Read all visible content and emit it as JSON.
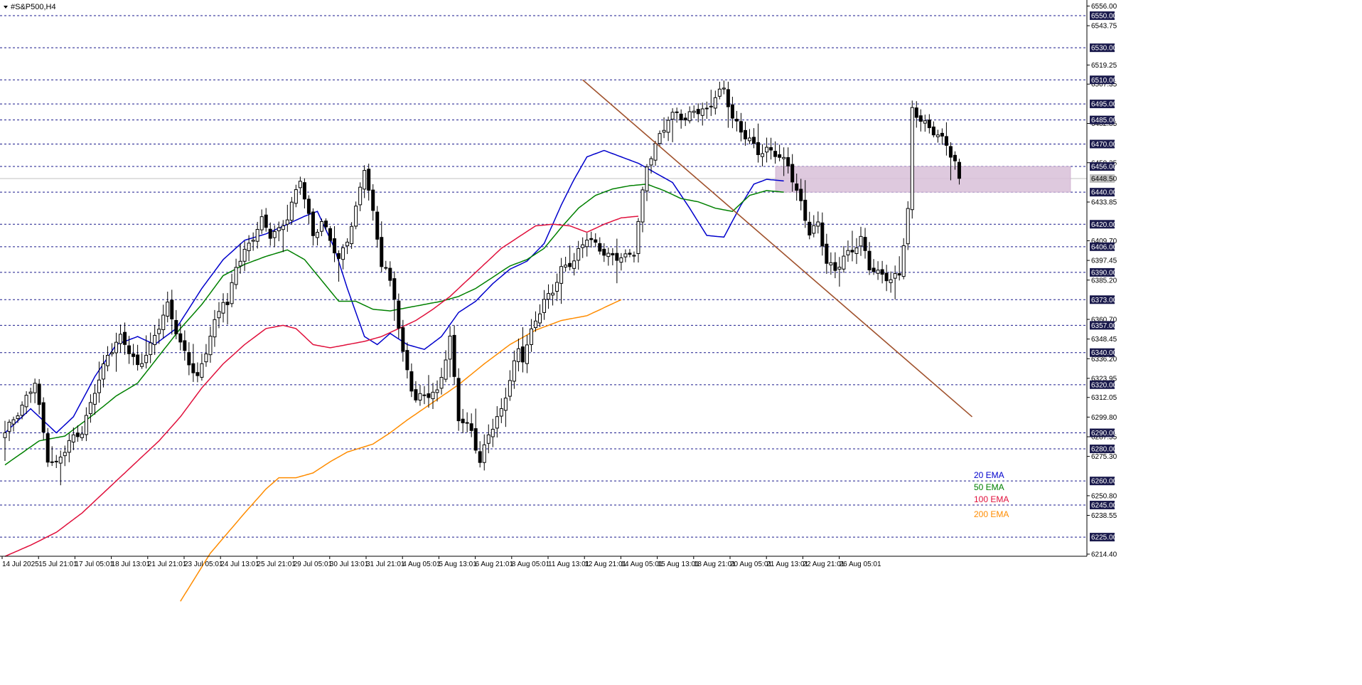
{
  "window": {
    "title": "#S&P500,H4"
  },
  "chart_data": {
    "type": "candlestick",
    "symbol": "#S&P500",
    "timeframe": "H4",
    "y_range": [
      6214.4,
      6556.0
    ],
    "y_ticks": [
      "6556.00",
      "6543.75",
      "6519.25",
      "6507.35",
      "6482.85",
      "6458.35",
      "6433.85",
      "6409.70",
      "6397.45",
      "6385.20",
      "6360.70",
      "6348.45",
      "6336.20",
      "6323.95",
      "6312.05",
      "6299.80",
      "6287.55",
      "6275.30",
      "6250.80",
      "6238.55",
      "6214.40"
    ],
    "level_labels": [
      "6550.00",
      "6530.00",
      "6510.00",
      "6495.00",
      "6485.00",
      "6470.00",
      "6456.00",
      "6440.00",
      "6420.00",
      "6406.00",
      "6390.00",
      "6373.00",
      "6357.00",
      "6340.00",
      "6320.00",
      "6290.00",
      "6280.00",
      "6260.00",
      "6245.00",
      "6225.00"
    ],
    "current_price": "6448.50",
    "x_labels": [
      "14 Jul 2025",
      "15 Jul 21:01",
      "17 Jul 05:01",
      "18 Jul 13:01",
      "21 Jul 21:01",
      "23 Jul 05:01",
      "24 Jul 13:01",
      "25 Jul 21:01",
      "29 Jul 05:01",
      "30 Jul 13:01",
      "31 Jul 21:01",
      "4 Aug 05:01",
      "5 Aug 13:01",
      "6 Aug 21:01",
      "8 Aug 05:01",
      "11 Aug 13:01",
      "12 Aug 21:01",
      "14 Aug 05:01",
      "15 Aug 13:01",
      "18 Aug 21:01",
      "20 Aug 05:01",
      "21 Aug 13:01",
      "22 Aug 21:01",
      "26 Aug 05:01"
    ],
    "legend": [
      {
        "name": "20 EMA",
        "color": "#0000cc"
      },
      {
        "name": "50 EMA",
        "color": "#008000"
      },
      {
        "name": "100 EMA",
        "color": "#e0103c"
      },
      {
        "name": "200 EMA",
        "color": "#ff8c00"
      }
    ],
    "zone": {
      "from": 6440,
      "to": 6456,
      "color": "#d8bfd8"
    },
    "trendline": {
      "color": "#a0522d",
      "start": {
        "bar": 135,
        "price": 6510
      },
      "end": {
        "bar": 226,
        "price": 6300
      }
    },
    "close_anchors": [
      [
        0,
        6290
      ],
      [
        4,
        6305
      ],
      [
        7,
        6323
      ],
      [
        10,
        6275
      ],
      [
        12,
        6270
      ],
      [
        15,
        6283
      ],
      [
        18,
        6291
      ],
      [
        21,
        6318
      ],
      [
        24,
        6338
      ],
      [
        27,
        6348
      ],
      [
        28,
        6345
      ],
      [
        31,
        6332
      ],
      [
        34,
        6345
      ],
      [
        38,
        6368
      ],
      [
        41,
        6345
      ],
      [
        43,
        6335
      ],
      [
        45,
        6325
      ],
      [
        48,
        6350
      ],
      [
        51,
        6372
      ],
      [
        52,
        6368
      ],
      [
        54,
        6395
      ],
      [
        56,
        6404
      ],
      [
        60,
        6422
      ],
      [
        62,
        6412
      ],
      [
        64,
        6415
      ],
      [
        66,
        6425
      ],
      [
        69,
        6450
      ],
      [
        72,
        6412
      ],
      [
        74,
        6420
      ],
      [
        76,
        6410
      ],
      [
        78,
        6398
      ],
      [
        80,
        6412
      ],
      [
        82,
        6430
      ],
      [
        84,
        6455
      ],
      [
        86,
        6425
      ],
      [
        88,
        6395
      ],
      [
        89,
        6392
      ],
      [
        91,
        6376
      ],
      [
        93,
        6340
      ],
      [
        95,
        6318
      ],
      [
        96,
        6310
      ],
      [
        98,
        6312
      ],
      [
        101,
        6315
      ],
      [
        104,
        6350
      ],
      [
        106,
        6300
      ],
      [
        109,
        6290
      ],
      [
        111,
        6270
      ],
      [
        113,
        6290
      ],
      [
        116,
        6305
      ],
      [
        118,
        6324
      ],
      [
        120,
        6341
      ],
      [
        121,
        6335
      ],
      [
        124,
        6360
      ],
      [
        126,
        6373
      ],
      [
        128,
        6380
      ],
      [
        130,
        6392
      ],
      [
        133,
        6396
      ],
      [
        136,
        6412
      ],
      [
        139,
        6406
      ],
      [
        141,
        6401
      ],
      [
        143,
        6399
      ],
      [
        145,
        6398
      ],
      [
        147,
        6402
      ],
      [
        149,
        6440
      ],
      [
        150,
        6458
      ],
      [
        153,
        6476
      ],
      [
        155,
        6485
      ],
      [
        157,
        6488
      ],
      [
        159,
        6484
      ],
      [
        161,
        6492
      ],
      [
        164,
        6492
      ],
      [
        166,
        6500
      ],
      [
        168,
        6503
      ],
      [
        170,
        6485
      ],
      [
        172,
        6478
      ],
      [
        174,
        6474
      ],
      [
        176,
        6466
      ],
      [
        178,
        6466
      ],
      [
        180,
        6463
      ],
      [
        183,
        6456
      ],
      [
        186,
        6434
      ],
      [
        188,
        6416
      ],
      [
        190,
        6420
      ],
      [
        192,
        6395
      ],
      [
        194,
        6390
      ],
      [
        196,
        6400
      ],
      [
        198,
        6405
      ],
      [
        200,
        6412
      ],
      [
        202,
        6393
      ],
      [
        204,
        6388
      ],
      [
        207,
        6385
      ],
      [
        209,
        6390
      ],
      [
        211,
        6430
      ],
      [
        212,
        6492
      ],
      [
        214,
        6485
      ],
      [
        216,
        6478
      ],
      [
        218,
        6475
      ],
      [
        220,
        6470
      ],
      [
        222,
        6460
      ],
      [
        223,
        6448
      ]
    ],
    "ema_anchors": {
      "ema20": [
        [
          0,
          6290
        ],
        [
          6,
          6305
        ],
        [
          12,
          6290
        ],
        [
          16,
          6300
        ],
        [
          21,
          6325
        ],
        [
          26,
          6345
        ],
        [
          31,
          6350
        ],
        [
          35,
          6345
        ],
        [
          40,
          6355
        ],
        [
          46,
          6380
        ],
        [
          51,
          6398
        ],
        [
          56,
          6410
        ],
        [
          61,
          6414
        ],
        [
          66,
          6420
        ],
        [
          70,
          6425
        ],
        [
          73,
          6428
        ],
        [
          77,
          6405
        ],
        [
          80,
          6380
        ],
        [
          84,
          6350
        ],
        [
          87,
          6345
        ],
        [
          90,
          6352
        ],
        [
          94,
          6345
        ],
        [
          98,
          6342
        ],
        [
          102,
          6350
        ],
        [
          106,
          6365
        ],
        [
          110,
          6372
        ],
        [
          114,
          6383
        ],
        [
          118,
          6392
        ],
        [
          122,
          6397
        ],
        [
          126,
          6408
        ],
        [
          130,
          6432
        ],
        [
          133,
          6448
        ],
        [
          136,
          6462
        ],
        [
          140,
          6466
        ],
        [
          144,
          6462
        ],
        [
          148,
          6458
        ],
        [
          152,
          6452
        ],
        [
          156,
          6446
        ],
        [
          160,
          6430
        ],
        [
          164,
          6413
        ],
        [
          168,
          6412
        ],
        [
          172,
          6432
        ],
        [
          175,
          6445
        ],
        [
          178,
          6448
        ],
        [
          182,
          6447
        ]
      ],
      "ema50": [
        [
          0,
          6270
        ],
        [
          8,
          6285
        ],
        [
          14,
          6288
        ],
        [
          20,
          6300
        ],
        [
          26,
          6313
        ],
        [
          31,
          6321
        ],
        [
          36,
          6338
        ],
        [
          41,
          6355
        ],
        [
          46,
          6370
        ],
        [
          51,
          6388
        ],
        [
          56,
          6395
        ],
        [
          61,
          6400
        ],
        [
          66,
          6404
        ],
        [
          70,
          6398
        ],
        [
          74,
          6385
        ],
        [
          78,
          6372
        ],
        [
          82,
          6372
        ],
        [
          86,
          6367
        ],
        [
          90,
          6366
        ],
        [
          94,
          6368
        ],
        [
          98,
          6370
        ],
        [
          102,
          6372
        ],
        [
          106,
          6375
        ],
        [
          110,
          6380
        ],
        [
          114,
          6387
        ],
        [
          118,
          6394
        ],
        [
          122,
          6398
        ],
        [
          126,
          6405
        ],
        [
          130,
          6418
        ],
        [
          134,
          6430
        ],
        [
          138,
          6438
        ],
        [
          142,
          6442
        ],
        [
          146,
          6444
        ],
        [
          150,
          6445
        ],
        [
          154,
          6441
        ],
        [
          158,
          6436
        ],
        [
          162,
          6434
        ],
        [
          166,
          6430
        ],
        [
          170,
          6428
        ],
        [
          174,
          6438
        ],
        [
          178,
          6441
        ],
        [
          182,
          6440
        ]
      ],
      "ema100": [
        [
          0,
          6213
        ],
        [
          6,
          6220
        ],
        [
          12,
          6228
        ],
        [
          18,
          6240
        ],
        [
          24,
          6255
        ],
        [
          30,
          6270
        ],
        [
          36,
          6285
        ],
        [
          41,
          6300
        ],
        [
          46,
          6318
        ],
        [
          51,
          6333
        ],
        [
          56,
          6345
        ],
        [
          61,
          6355
        ],
        [
          65,
          6357
        ],
        [
          68,
          6355
        ],
        [
          72,
          6345
        ],
        [
          76,
          6343
        ],
        [
          80,
          6345
        ],
        [
          84,
          6347
        ],
        [
          88,
          6350
        ],
        [
          92,
          6355
        ],
        [
          96,
          6360
        ],
        [
          100,
          6367
        ],
        [
          104,
          6375
        ],
        [
          108,
          6385
        ],
        [
          112,
          6395
        ],
        [
          116,
          6405
        ],
        [
          120,
          6412
        ],
        [
          124,
          6419
        ],
        [
          128,
          6420
        ],
        [
          132,
          6419
        ],
        [
          136,
          6415
        ],
        [
          140,
          6420
        ],
        [
          144,
          6424
        ],
        [
          148,
          6425
        ]
      ],
      "ema200": [
        [
          41,
          6185
        ],
        [
          48,
          6215
        ],
        [
          56,
          6240
        ],
        [
          61,
          6255
        ],
        [
          64,
          6262
        ],
        [
          68,
          6262
        ],
        [
          72,
          6265
        ],
        [
          76,
          6272
        ],
        [
          80,
          6278
        ],
        [
          86,
          6283
        ],
        [
          90,
          6290
        ],
        [
          94,
          6298
        ],
        [
          100,
          6309
        ],
        [
          106,
          6320
        ],
        [
          112,
          6333
        ],
        [
          118,
          6345
        ],
        [
          124,
          6354
        ],
        [
          130,
          6360
        ],
        [
          136,
          6363
        ],
        [
          140,
          6368
        ],
        [
          144,
          6373
        ]
      ]
    }
  }
}
